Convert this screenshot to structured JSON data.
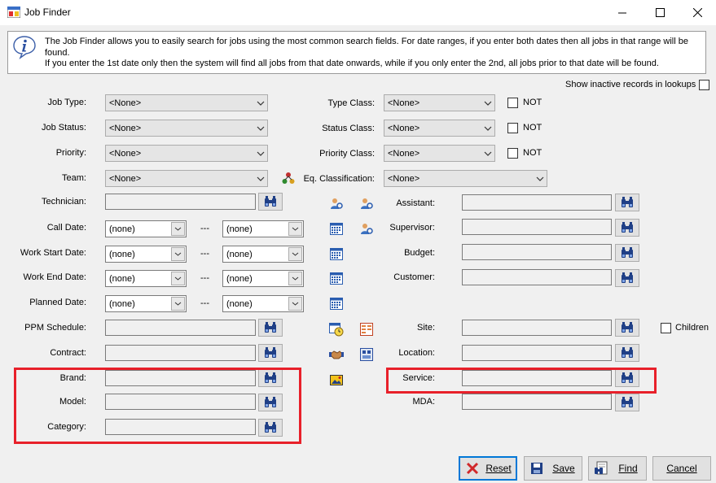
{
  "window": {
    "title": "Job Finder"
  },
  "info": {
    "line1": "The Job Finder allows you to easily search for jobs using the most common search fields. For date ranges, if you enter both dates then all jobs in that range will be found.",
    "line2": "If you enter the 1st date only then the system will find all jobs from that date onwards, while if you only enter the 2nd, all jobs prior to that date will be found."
  },
  "show_inactive_label": "Show inactive records in lookups",
  "left": {
    "job_type": {
      "label": "Job Type:",
      "value": "<None>"
    },
    "job_status": {
      "label": "Job Status:",
      "value": "<None>"
    },
    "priority": {
      "label": "Priority:",
      "value": "<None>"
    },
    "team": {
      "label": "Team:",
      "value": "<None>"
    },
    "technician": {
      "label": "Technician:"
    },
    "call_date": {
      "label": "Call Date:",
      "from": "(none)",
      "to": "(none)"
    },
    "work_start_date": {
      "label": "Work Start Date:",
      "from": "(none)",
      "to": "(none)"
    },
    "work_end_date": {
      "label": "Work End Date:",
      "from": "(none)",
      "to": "(none)"
    },
    "planned_date": {
      "label": "Planned Date:",
      "from": "(none)",
      "to": "(none)"
    },
    "ppm_schedule": {
      "label": "PPM Schedule:"
    },
    "contract": {
      "label": "Contract:"
    },
    "brand": {
      "label": "Brand:"
    },
    "model": {
      "label": "Model:"
    },
    "category": {
      "label": "Category:"
    }
  },
  "date_separator": "---",
  "right": {
    "type_class": {
      "label": "Type Class:",
      "value": "<None>",
      "not_label": "NOT"
    },
    "status_class": {
      "label": "Status Class:",
      "value": "<None>",
      "not_label": "NOT"
    },
    "priority_class": {
      "label": "Priority Class:",
      "value": "<None>",
      "not_label": "NOT"
    },
    "eq_classification": {
      "label": "Eq. Classification:",
      "value": "<None>"
    },
    "assistant": {
      "label": "Assistant:"
    },
    "supervisor": {
      "label": "Supervisor:"
    },
    "budget": {
      "label": "Budget:"
    },
    "customer": {
      "label": "Customer:"
    },
    "site": {
      "label": "Site:",
      "children_label": "Children"
    },
    "location": {
      "label": "Location:"
    },
    "service": {
      "label": "Service:"
    },
    "mda": {
      "label": "MDA:"
    }
  },
  "buttons": {
    "reset": "Reset",
    "save": "Save",
    "find": "Find",
    "cancel": "Cancel"
  },
  "colors": {
    "highlight": "#e8202a",
    "focus": "#0078d7"
  }
}
